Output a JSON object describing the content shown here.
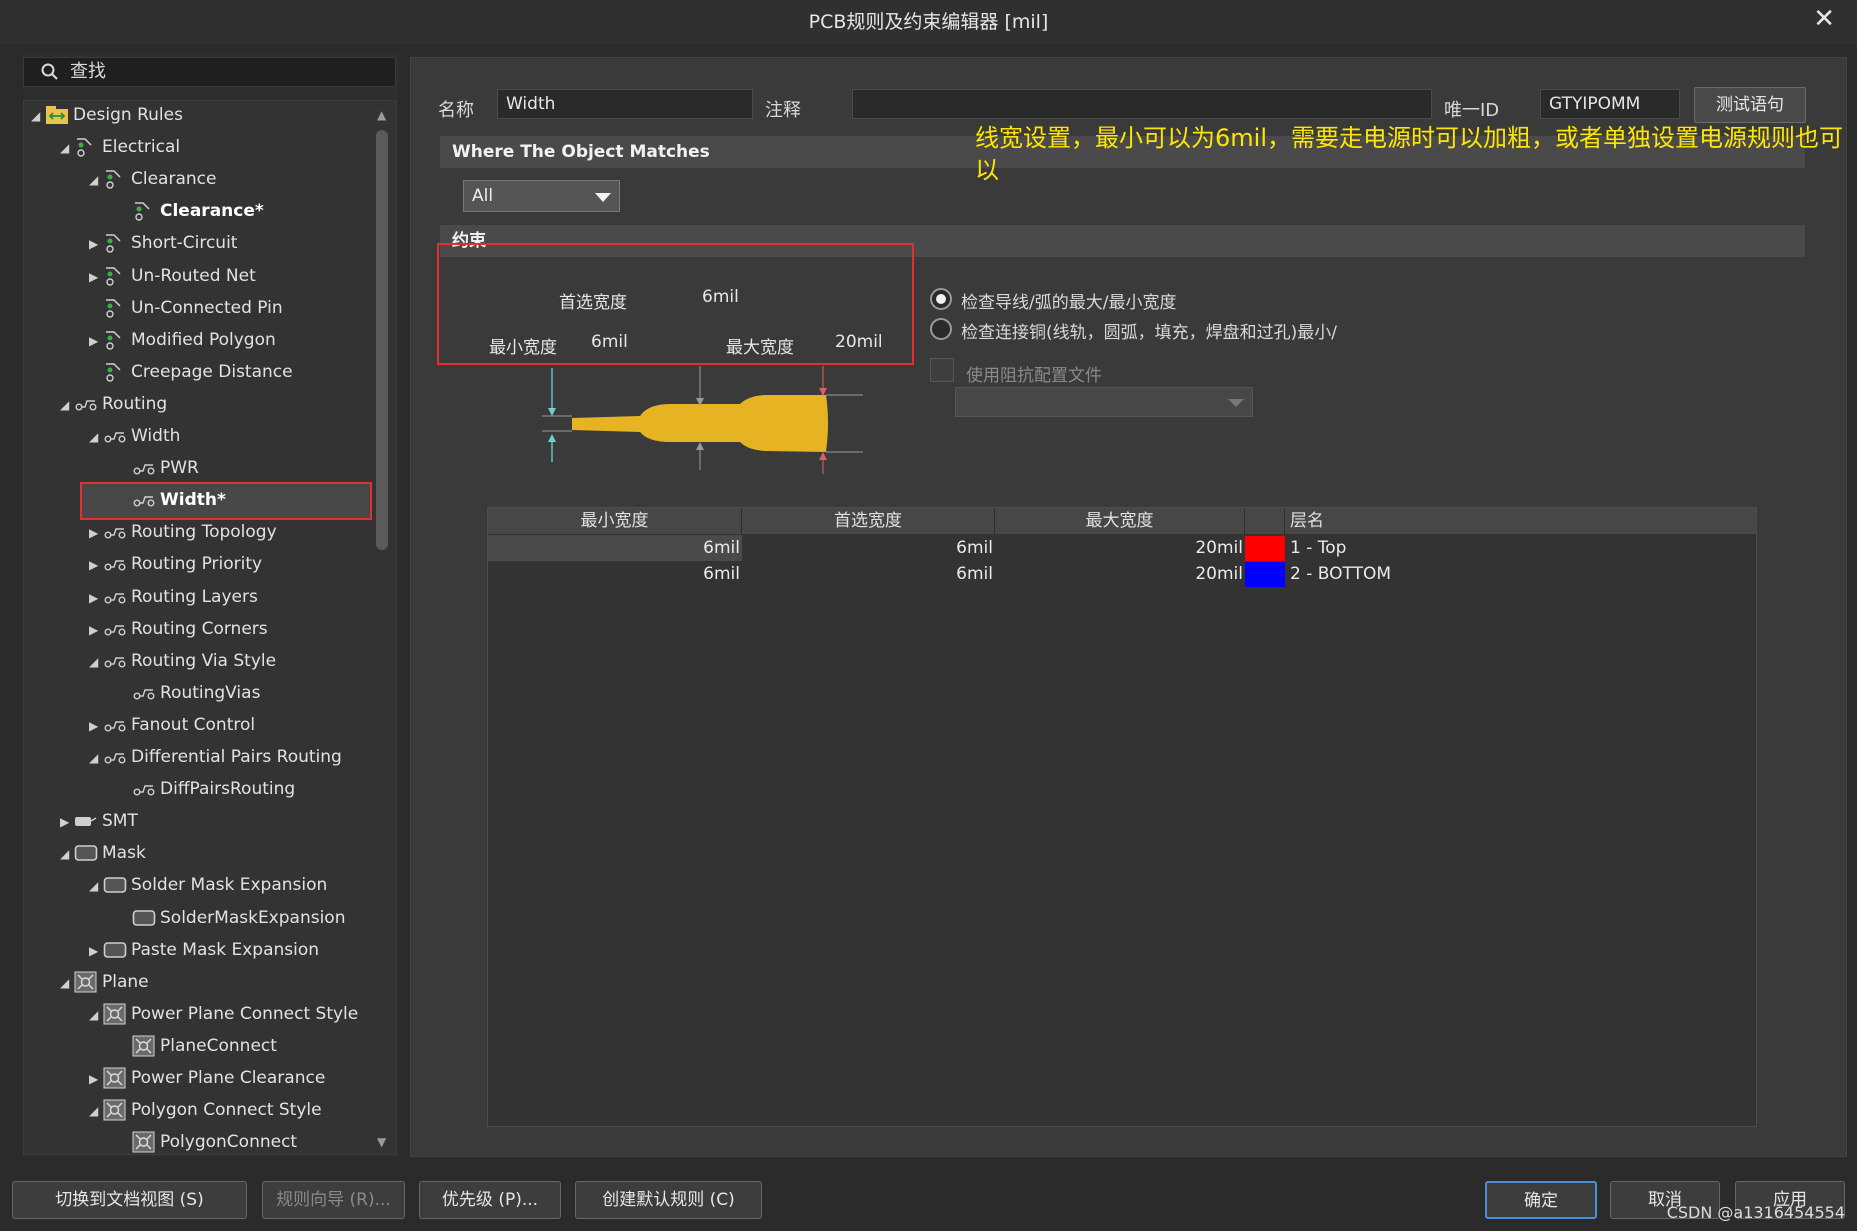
{
  "window": {
    "title": "PCB规则及约束编辑器 [mil]",
    "close": "✕"
  },
  "search": {
    "placeholder": "查找"
  },
  "tree": [
    {
      "label": "Design Rules",
      "arrow": "◢",
      "icon": "design-rules-icon"
    },
    {
      "label": "Electrical",
      "arrow": "◢",
      "icon": "rule-icon"
    },
    {
      "label": "Clearance",
      "arrow": "◢",
      "icon": "rule-icon"
    },
    {
      "label": "Clearance*",
      "arrow": "",
      "icon": "rule-icon",
      "bold": true
    },
    {
      "label": "Short-Circuit",
      "arrow": "▶",
      "icon": "rule-icon"
    },
    {
      "label": "Un-Routed Net",
      "arrow": "▶",
      "icon": "rule-icon"
    },
    {
      "label": "Un-Connected Pin",
      "arrow": "",
      "icon": "rule-icon"
    },
    {
      "label": "Modified Polygon",
      "arrow": "▶",
      "icon": "rule-icon"
    },
    {
      "label": "Creepage Distance",
      "arrow": "",
      "icon": "rule-icon"
    },
    {
      "label": "Routing",
      "arrow": "◢",
      "icon": "route-icon"
    },
    {
      "label": "Width",
      "arrow": "◢",
      "icon": "route-icon"
    },
    {
      "label": "PWR",
      "arrow": "",
      "icon": "route-icon"
    },
    {
      "label": "Width*",
      "arrow": "",
      "icon": "route-icon",
      "bold": true
    },
    {
      "label": "Routing Topology",
      "arrow": "▶",
      "icon": "route-icon"
    },
    {
      "label": "Routing Priority",
      "arrow": "▶",
      "icon": "route-icon"
    },
    {
      "label": "Routing Layers",
      "arrow": "▶",
      "icon": "route-icon"
    },
    {
      "label": "Routing Corners",
      "arrow": "▶",
      "icon": "route-icon"
    },
    {
      "label": "Routing Via Style",
      "arrow": "◢",
      "icon": "route-icon"
    },
    {
      "label": "RoutingVias",
      "arrow": "",
      "icon": "route-icon"
    },
    {
      "label": "Fanout Control",
      "arrow": "▶",
      "icon": "route-icon"
    },
    {
      "label": "Differential Pairs Routing",
      "arrow": "◢",
      "icon": "route-icon"
    },
    {
      "label": "DiffPairsRouting",
      "arrow": "",
      "icon": "route-icon"
    },
    {
      "label": "SMT",
      "arrow": "▶",
      "icon": "smt-icon"
    },
    {
      "label": "Mask",
      "arrow": "◢",
      "icon": "mask-icon"
    },
    {
      "label": "Solder Mask Expansion",
      "arrow": "◢",
      "icon": "mask-icon"
    },
    {
      "label": "SolderMaskExpansion",
      "arrow": "",
      "icon": "mask-icon"
    },
    {
      "label": "Paste Mask Expansion",
      "arrow": "▶",
      "icon": "mask-icon"
    },
    {
      "label": "Plane",
      "arrow": "◢",
      "icon": "plane-icon"
    },
    {
      "label": "Power Plane Connect Style",
      "arrow": "◢",
      "icon": "plane-icon"
    },
    {
      "label": "PlaneConnect",
      "arrow": "",
      "icon": "plane-icon"
    },
    {
      "label": "Power Plane Clearance",
      "arrow": "▶",
      "icon": "plane-icon"
    },
    {
      "label": "Polygon Connect Style",
      "arrow": "◢",
      "icon": "plane-icon"
    },
    {
      "label": "PolygonConnect",
      "arrow": "",
      "icon": "plane-icon"
    }
  ],
  "rule": {
    "name_label": "名称",
    "name_value": "Width",
    "comment_label": "注释",
    "comment_value": "",
    "uid_label": "唯一ID",
    "uid_value": "GTYIPOMM",
    "test_button": "测试语句"
  },
  "annotation": "线宽设置，最小可以为6mil，需要走电源时可以加粗，或者单独设置电源规则也可以",
  "match": {
    "section_title": "Where The Object Matches",
    "scope": "All"
  },
  "constraints": {
    "section_title": "约束",
    "preferred_label": "首选宽度",
    "preferred_value": "6mil",
    "min_label": "最小宽度",
    "min_value": "6mil",
    "max_label": "最大宽度",
    "max_value": "20mil",
    "radio1": "检查导线/弧的最大/最小宽度",
    "radio2": "检查连接铜(线轨，圆弧，填充，焊盘和过孔)最小/",
    "impedance_checkbox": "使用阻抗配置文件"
  },
  "layer_table": {
    "headers": [
      "最小宽度",
      "首选宽度",
      "最大宽度",
      "层名"
    ],
    "rows": [
      {
        "min": "6mil",
        "pref": "6mil",
        "max": "20mil",
        "color": "#ff0000",
        "layer": "1 - Top"
      },
      {
        "min": "6mil",
        "pref": "6mil",
        "max": "20mil",
        "color": "#0000ff",
        "layer": "2 - BOTTOM"
      }
    ]
  },
  "footer": {
    "doc_view": "切换到文档视图 (S)",
    "wizard": "规则向导 (R)...",
    "priority": "优先级 (P)...",
    "create_default": "创建默认规则 (C)",
    "ok": "确定",
    "cancel": "取消",
    "apply": "应用"
  },
  "watermark": "CSDN @a1316454554",
  "colors": {
    "trace": "#e6b422",
    "highlight": "#e03030",
    "annotation": "#ffe600"
  }
}
